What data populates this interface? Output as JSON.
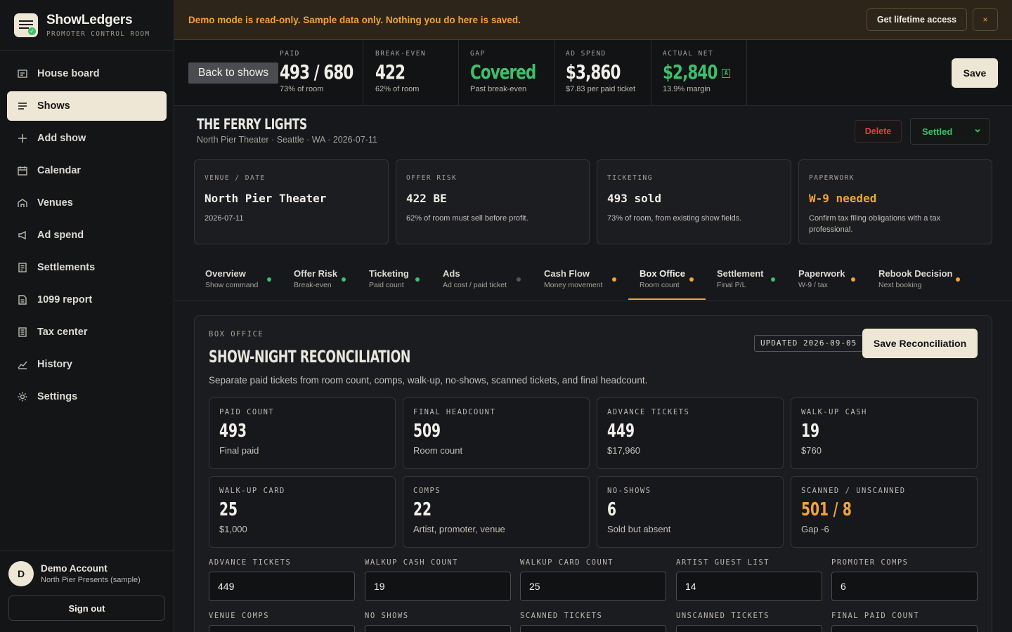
{
  "brand": {
    "name": "ShowLedgers",
    "subtitle": "PROMOTER CONTROL ROOM"
  },
  "sidebar": {
    "items": [
      {
        "label": "House board",
        "icon": "board-icon"
      },
      {
        "label": "Shows",
        "icon": "list-icon",
        "active": true
      },
      {
        "label": "Add show",
        "icon": "plus-icon"
      },
      {
        "label": "Calendar",
        "icon": "calendar-icon"
      },
      {
        "label": "Venues",
        "icon": "venue-icon"
      },
      {
        "label": "Ad spend",
        "icon": "megaphone-icon"
      },
      {
        "label": "Settlements",
        "icon": "receipt-icon"
      },
      {
        "label": "1099 report",
        "icon": "document-icon"
      },
      {
        "label": "Tax center",
        "icon": "tax-icon"
      },
      {
        "label": "History",
        "icon": "chart-icon"
      },
      {
        "label": "Settings",
        "icon": "gear-icon"
      }
    ]
  },
  "account": {
    "initial": "D",
    "name": "Demo Account",
    "org": "North Pier Presents (sample)",
    "signout": "Sign out"
  },
  "banner": {
    "text": "Demo mode is read-only. Sample data only. Nothing you do here is saved.",
    "cta": "Get lifetime access",
    "close": "×"
  },
  "metrics": {
    "back": "Back to shows",
    "paid": {
      "label": "PAID",
      "value": "493 / 680",
      "sub": "73% of room"
    },
    "breakeven": {
      "label": "BREAK-EVEN",
      "value": "422",
      "sub": "62% of room"
    },
    "gap": {
      "label": "GAP",
      "value": "Covered",
      "sub": "Past break-even"
    },
    "adspend": {
      "label": "AD SPEND",
      "value": "$3,860",
      "sub": "$7.83 per paid ticket"
    },
    "net": {
      "label": "ACTUAL NET",
      "value": "$2,840",
      "badge": "A",
      "sub": "13.9% margin"
    },
    "save": "Save"
  },
  "show": {
    "title": "THE FERRY LIGHTS",
    "subtitle": "North Pier Theater · Seattle · WA · 2026-07-11",
    "delete": "Delete",
    "status": "Settled"
  },
  "cards": [
    {
      "label": "VENUE / DATE",
      "value": "North Pier Theater",
      "note": "2026-07-11"
    },
    {
      "label": "OFFER RISK",
      "value": "422 BE",
      "note": "62% of room must sell before profit."
    },
    {
      "label": "TICKETING",
      "value": "493 sold",
      "note": "73% of room, from existing show fields."
    },
    {
      "label": "PAPERWORK",
      "value": "W-9 needed",
      "note": "Confirm tax filing obligations with a tax professional."
    }
  ],
  "tabs": [
    {
      "label": "Overview",
      "sub": "Show command",
      "dot": "#3fbf6a"
    },
    {
      "label": "Offer Risk",
      "sub": "Break-even",
      "dot": "#3fbf6a"
    },
    {
      "label": "Ticketing",
      "sub": "Paid count",
      "dot": "#3fbf6a"
    },
    {
      "label": "Ads",
      "sub": "Ad cost / paid ticket",
      "dot": "#55565b"
    },
    {
      "label": "Cash Flow",
      "sub": "Money movement",
      "dot": "#f2a33a"
    },
    {
      "label": "Box Office",
      "sub": "Room count",
      "dot": "#f2a33a",
      "active": true
    },
    {
      "label": "Settlement",
      "sub": "Final P/L",
      "dot": "#3fbf6a"
    },
    {
      "label": "Paperwork",
      "sub": "W-9 / tax",
      "dot": "#f2a33a"
    },
    {
      "label": "Rebook Decision",
      "sub": "Next booking",
      "dot": "#f2a33a"
    }
  ],
  "panel": {
    "eyebrow": "BOX OFFICE",
    "title": "SHOW-NIGHT RECONCILIATION",
    "desc": "Separate paid tickets from room count, comps, walk-up, no-shows, scanned tickets, and final headcount.",
    "updated": "UPDATED 2026-09-05",
    "save": "Save Reconciliation",
    "stats": [
      {
        "label": "PAID COUNT",
        "value": "493",
        "sub": "Final paid"
      },
      {
        "label": "FINAL HEADCOUNT",
        "value": "509",
        "sub": "Room count"
      },
      {
        "label": "ADVANCE TICKETS",
        "value": "449",
        "sub": "$17,960"
      },
      {
        "label": "WALK-UP CASH",
        "value": "19",
        "sub": "$760"
      },
      {
        "label": "WALK-UP CARD",
        "value": "25",
        "sub": "$1,000"
      },
      {
        "label": "COMPS",
        "value": "22",
        "sub": "Artist, promoter, venue"
      },
      {
        "label": "NO-SHOWS",
        "value": "6",
        "sub": "Sold but absent"
      },
      {
        "label": "SCANNED / UNSCANNED",
        "value": "501 / 8",
        "sub": "Gap -6"
      }
    ],
    "fields": [
      {
        "label": "ADVANCE TICKETS",
        "value": "449"
      },
      {
        "label": "WALKUP CASH COUNT",
        "value": "19"
      },
      {
        "label": "WALKUP CARD COUNT",
        "value": "25"
      },
      {
        "label": "ARTIST GUEST LIST",
        "value": "14"
      },
      {
        "label": "PROMOTER COMPS",
        "value": "6"
      },
      {
        "label": "VENUE COMPS",
        "value": ""
      },
      {
        "label": "NO SHOWS",
        "value": ""
      },
      {
        "label": "SCANNED TICKETS",
        "value": ""
      },
      {
        "label": "UNSCANNED TICKETS",
        "value": ""
      },
      {
        "label": "FINAL PAID COUNT",
        "value": ""
      }
    ]
  }
}
